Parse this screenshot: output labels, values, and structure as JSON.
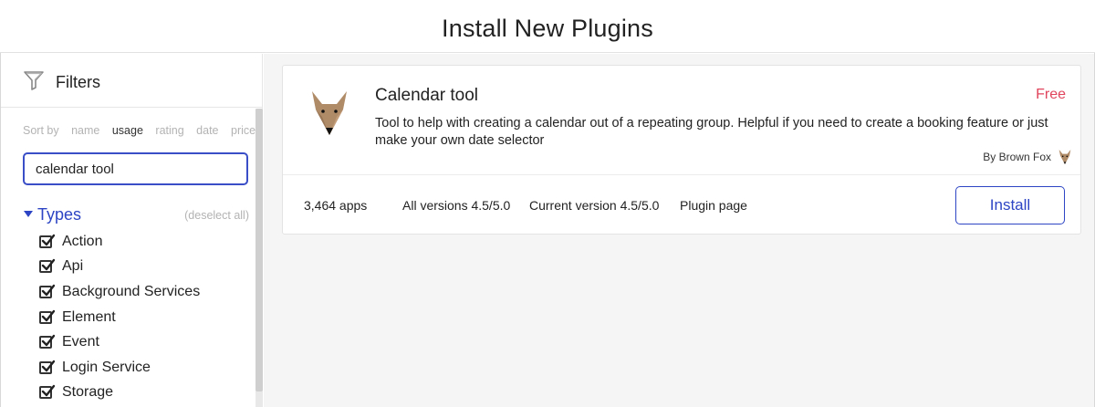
{
  "header": {
    "title": "Install New Plugins"
  },
  "sidebar": {
    "filters_label": "Filters",
    "sort": {
      "label": "Sort by",
      "options": [
        "name",
        "usage",
        "rating",
        "date",
        "price"
      ],
      "active": "usage"
    },
    "search": {
      "value": "calendar tool"
    },
    "types": {
      "label": "Types",
      "deselect_label": "(deselect all)",
      "items": [
        {
          "label": "Action",
          "checked": true
        },
        {
          "label": "Api",
          "checked": true
        },
        {
          "label": "Background Services",
          "checked": true
        },
        {
          "label": "Element",
          "checked": true
        },
        {
          "label": "Event",
          "checked": true
        },
        {
          "label": "Login Service",
          "checked": true
        },
        {
          "label": "Storage",
          "checked": true
        }
      ]
    }
  },
  "plugin": {
    "name": "Calendar tool",
    "price": "Free",
    "description": "Tool to help with creating a calendar out of a repeating group. Helpful if you need to create a booking feature or just make your own date selector",
    "author": "By Brown Fox",
    "icon": "fox-logo-icon",
    "apps": "3,464 apps",
    "all_versions": "All versions 4.5/5.0",
    "current_version": "Current version 4.5/5.0",
    "plugin_page": "Plugin page",
    "install_label": "Install"
  },
  "colors": {
    "accent": "#2d45c4",
    "price": "#e0445c",
    "fox": "#b08b68"
  }
}
